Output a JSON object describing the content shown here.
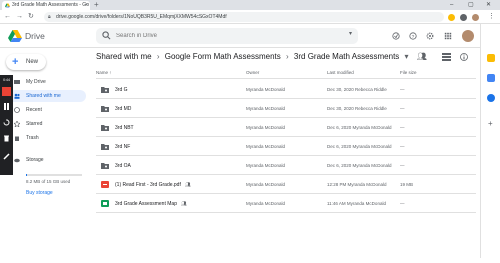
{
  "browser": {
    "tab_title": "3rd Grade Math Assessments - Go",
    "tab_close": "×",
    "new_tab": "+",
    "url": "drive.google.com/drive/folders/1NoUQB3R5U_EMqmjXXMW54cSGxOT4Mdf",
    "window_controls": {
      "minimize": "–",
      "maximize": "▢",
      "close": "✕"
    }
  },
  "drive": {
    "app_name": "Drive",
    "search_placeholder": "Search in Drive",
    "user_initial": ""
  },
  "sidebar": {
    "new_label": "New",
    "items": [
      {
        "label": "My Drive",
        "icon": "my-drive-icon"
      },
      {
        "label": "Shared with me",
        "icon": "people-icon"
      },
      {
        "label": "Recent",
        "icon": "clock-icon"
      },
      {
        "label": "Starred",
        "icon": "star-icon"
      },
      {
        "label": "Trash",
        "icon": "trash-icon"
      }
    ],
    "storage_label": "Storage",
    "storage_used": "8.2 MB of 15 GB used",
    "storage_fraction": 0.001,
    "buy_storage": "Buy storage"
  },
  "recording": {
    "time": "0:44"
  },
  "breadcrumb": [
    "Shared with me",
    "Google Form Math Assessments",
    "3rd Grade Math Assessments"
  ],
  "list": {
    "headers": {
      "name": "Name",
      "owner": "Owner",
      "modified": "Last modified",
      "size": "File size"
    },
    "sort_arrow": "↑",
    "rows": [
      {
        "name": "3rd G",
        "type": "shared-folder",
        "owner": "Myranda McDonald",
        "modified": "Dec 30, 2020 Rebecca Riddle",
        "size": "—",
        "shared": false
      },
      {
        "name": "3rd MD",
        "type": "shared-folder",
        "owner": "Myranda McDonald",
        "modified": "Dec 30, 2020 Rebecca Riddle",
        "size": "—",
        "shared": false
      },
      {
        "name": "3rd NBT",
        "type": "shared-folder",
        "owner": "Myranda McDonald",
        "modified": "Dec 6, 2020 Myranda McDonald",
        "size": "—",
        "shared": false
      },
      {
        "name": "3rd NF",
        "type": "shared-folder",
        "owner": "Myranda McDonald",
        "modified": "Dec 6, 2020 Myranda McDonald",
        "size": "—",
        "shared": false
      },
      {
        "name": "3rd OA",
        "type": "shared-folder",
        "owner": "Myranda McDonald",
        "modified": "Dec 6, 2020 Myranda McDonald",
        "size": "—",
        "shared": false
      },
      {
        "name": "(1) Read First - 3rd Grade.pdf",
        "type": "pdf",
        "owner": "Myranda McDonald",
        "modified": "12:28 PM Myranda McDonald",
        "size": "19 MB",
        "shared": true
      },
      {
        "name": "3rd Grade Assessment Map",
        "type": "sheet",
        "owner": "Myranda McDonald",
        "modified": "11:46 AM Myranda McDonald",
        "size": "—",
        "shared": true
      }
    ]
  },
  "colors": {
    "accent": "#1a73e8",
    "folder": "#5f6368",
    "pdf": "#ea4335",
    "sheet": "#0f9d58",
    "record": "#ea4335"
  }
}
